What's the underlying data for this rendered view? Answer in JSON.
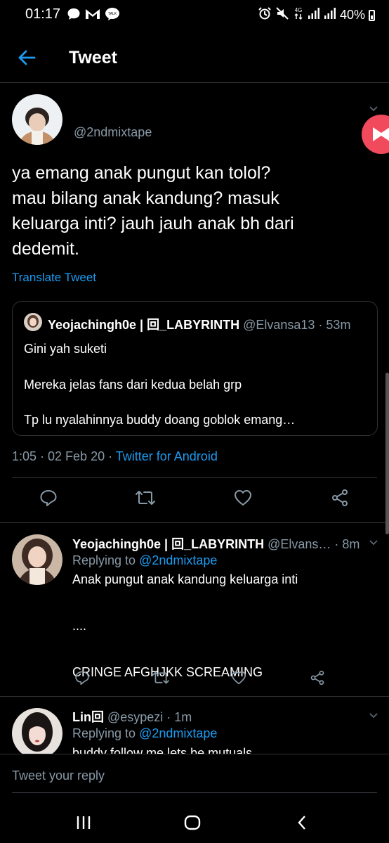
{
  "status_bar": {
    "time": "01:17",
    "battery": "40%",
    "network": "4G"
  },
  "header": {
    "title": "Tweet"
  },
  "main_tweet": {
    "handle": "@2ndmixtape",
    "text": "ya emang anak pungut kan tolol?\nmau bilang anak kandung? masuk\nkeluarga inti? jauh jauh anak bh dari\ndedemit.",
    "translate_label": "Translate Tweet",
    "timestamp": "1:05 · 02 Feb 20 · ",
    "client": "Twitter for Android"
  },
  "quoted_tweet": {
    "name": "Yeojachingh0e | 回_LABYRINTH",
    "handle_time": " @Elvansa13 · 53m",
    "lines": [
      "Gini yah suketi",
      "Mereka jelas fans dari kedua belah grp",
      "Tp lu nyalahinnya buddy doang goblok emang…"
    ]
  },
  "replies": [
    {
      "name": "Yeojachingh0e | 回_LABYRINTH",
      "handle_time": " @Elvans… · 8m",
      "replying_prefix": "Replying to ",
      "replying_to": "@2ndmixtape",
      "text": "Anak pungut anak kandung keluarga inti\n\n....\n\nCRINGE AFGHJKK SCREAMING"
    },
    {
      "name": "Lin回",
      "handle_time": " @esypezi · 1m",
      "replying_prefix": "Replying to ",
      "replying_to": "@2ndmixtape",
      "text": "buddy follow me lets be mutuals"
    }
  ],
  "reply_bar": {
    "placeholder": "Tweet your reply"
  },
  "colors": {
    "accent": "#1d9bf0",
    "muted": "#8899a6",
    "background": "#000000",
    "badge": "#f04a5c"
  }
}
